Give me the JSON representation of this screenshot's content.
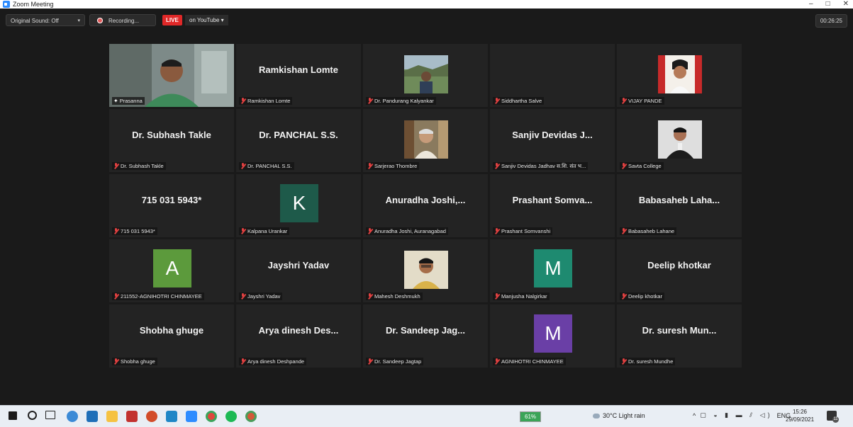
{
  "window": {
    "title": "Zoom Meeting",
    "controls": [
      "–",
      "□",
      "✕"
    ]
  },
  "topbar": {
    "sound": "Original Sound: Off",
    "sound_caret": "▾",
    "recording": "Recording...",
    "live": "LIVE",
    "on_youtube": "on YouTube ▾",
    "timer": "00:26:25"
  },
  "tiles": [
    {
      "big": "",
      "label": "Prasanna",
      "type": "video",
      "pinned": true
    },
    {
      "big": "Ramkishan Lomte",
      "label": "Ramkishan Lomte",
      "type": "name"
    },
    {
      "big": "",
      "label": "Dr. Pandurang Kalyankar",
      "type": "photo"
    },
    {
      "big": "",
      "label": "Siddhartha Salve",
      "type": "blank"
    },
    {
      "big": "",
      "label": "VIJAY PANDE",
      "type": "photo"
    },
    {
      "big": "Dr. Subhash Takle",
      "label": "Dr. Subhash Takle",
      "type": "name"
    },
    {
      "big": "Dr. PANCHAL S.S.",
      "label": "Dr. PANCHAL S.S.",
      "type": "name"
    },
    {
      "big": "",
      "label": "Sarjerao Thombre",
      "type": "photo"
    },
    {
      "big": "Sanjiv Devidas J...",
      "label": "Sanjiv Devidas Jadhav स.शि. संत भ...",
      "type": "name"
    },
    {
      "big": "",
      "label": "Savta College",
      "type": "photo"
    },
    {
      "big": "715 031 5943*",
      "label": "715 031 5943*",
      "type": "name"
    },
    {
      "big": "K",
      "label": "Kalpana Urankar",
      "type": "letter",
      "color": "#1e5a4a"
    },
    {
      "big": "Anuradha Joshi,...",
      "label": "Anuradha Joshi, Auranagabad",
      "type": "name"
    },
    {
      "big": "Prashant Somva...",
      "label": "Prashant Somvanshi",
      "type": "name"
    },
    {
      "big": "Babasaheb Laha...",
      "label": "Babasaheb Lahane",
      "type": "name"
    },
    {
      "big": "A",
      "label": "211552-AGNIHOTRI CHINMAYEE",
      "type": "letter",
      "color": "#5c9a3c"
    },
    {
      "big": "Jayshri Yadav",
      "label": "Jayshri Yadav",
      "type": "name"
    },
    {
      "big": "",
      "label": "Mahesh Deshmukh",
      "type": "photo"
    },
    {
      "big": "M",
      "label": "Manjusha Nalgirkar",
      "type": "letter",
      "color": "#1e8a70"
    },
    {
      "big": "Deelip khotkar",
      "label": "Deelip khotkar",
      "type": "name"
    },
    {
      "big": "Shobha ghuge",
      "label": "Shobha ghuge",
      "type": "name"
    },
    {
      "big": "Arya dinesh Des...",
      "label": "Arya dinesh Deshpande",
      "type": "name"
    },
    {
      "big": "Dr. Sandeep Jag...",
      "label": "Dr. Sandeep Jagtap",
      "type": "name"
    },
    {
      "big": "M",
      "label": "AGNIHOTRI CHINMAYEE",
      "type": "letter",
      "color": "#6a3fa6"
    },
    {
      "big": "Dr. suresh Mun...",
      "label": "Dr. suresh Mundhe",
      "type": "name"
    }
  ],
  "taskbar": {
    "battery": "61%",
    "weather": "30°C  Light rain",
    "tray": "^  ENG",
    "time": "15:26",
    "date": "29/09/2021"
  }
}
